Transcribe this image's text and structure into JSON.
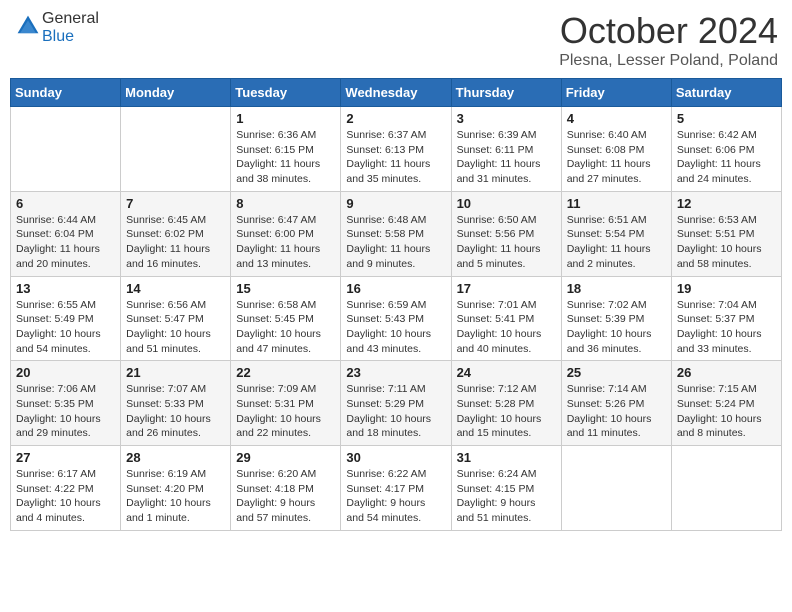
{
  "header": {
    "logo_general": "General",
    "logo_blue": "Blue",
    "month_title": "October 2024",
    "location": "Plesna, Lesser Poland, Poland"
  },
  "days_of_week": [
    "Sunday",
    "Monday",
    "Tuesday",
    "Wednesday",
    "Thursday",
    "Friday",
    "Saturday"
  ],
  "weeks": [
    [
      {
        "day": "",
        "info": ""
      },
      {
        "day": "",
        "info": ""
      },
      {
        "day": "1",
        "info": "Sunrise: 6:36 AM\nSunset: 6:15 PM\nDaylight: 11 hours and 38 minutes."
      },
      {
        "day": "2",
        "info": "Sunrise: 6:37 AM\nSunset: 6:13 PM\nDaylight: 11 hours and 35 minutes."
      },
      {
        "day": "3",
        "info": "Sunrise: 6:39 AM\nSunset: 6:11 PM\nDaylight: 11 hours and 31 minutes."
      },
      {
        "day": "4",
        "info": "Sunrise: 6:40 AM\nSunset: 6:08 PM\nDaylight: 11 hours and 27 minutes."
      },
      {
        "day": "5",
        "info": "Sunrise: 6:42 AM\nSunset: 6:06 PM\nDaylight: 11 hours and 24 minutes."
      }
    ],
    [
      {
        "day": "6",
        "info": "Sunrise: 6:44 AM\nSunset: 6:04 PM\nDaylight: 11 hours and 20 minutes."
      },
      {
        "day": "7",
        "info": "Sunrise: 6:45 AM\nSunset: 6:02 PM\nDaylight: 11 hours and 16 minutes."
      },
      {
        "day": "8",
        "info": "Sunrise: 6:47 AM\nSunset: 6:00 PM\nDaylight: 11 hours and 13 minutes."
      },
      {
        "day": "9",
        "info": "Sunrise: 6:48 AM\nSunset: 5:58 PM\nDaylight: 11 hours and 9 minutes."
      },
      {
        "day": "10",
        "info": "Sunrise: 6:50 AM\nSunset: 5:56 PM\nDaylight: 11 hours and 5 minutes."
      },
      {
        "day": "11",
        "info": "Sunrise: 6:51 AM\nSunset: 5:54 PM\nDaylight: 11 hours and 2 minutes."
      },
      {
        "day": "12",
        "info": "Sunrise: 6:53 AM\nSunset: 5:51 PM\nDaylight: 10 hours and 58 minutes."
      }
    ],
    [
      {
        "day": "13",
        "info": "Sunrise: 6:55 AM\nSunset: 5:49 PM\nDaylight: 10 hours and 54 minutes."
      },
      {
        "day": "14",
        "info": "Sunrise: 6:56 AM\nSunset: 5:47 PM\nDaylight: 10 hours and 51 minutes."
      },
      {
        "day": "15",
        "info": "Sunrise: 6:58 AM\nSunset: 5:45 PM\nDaylight: 10 hours and 47 minutes."
      },
      {
        "day": "16",
        "info": "Sunrise: 6:59 AM\nSunset: 5:43 PM\nDaylight: 10 hours and 43 minutes."
      },
      {
        "day": "17",
        "info": "Sunrise: 7:01 AM\nSunset: 5:41 PM\nDaylight: 10 hours and 40 minutes."
      },
      {
        "day": "18",
        "info": "Sunrise: 7:02 AM\nSunset: 5:39 PM\nDaylight: 10 hours and 36 minutes."
      },
      {
        "day": "19",
        "info": "Sunrise: 7:04 AM\nSunset: 5:37 PM\nDaylight: 10 hours and 33 minutes."
      }
    ],
    [
      {
        "day": "20",
        "info": "Sunrise: 7:06 AM\nSunset: 5:35 PM\nDaylight: 10 hours and 29 minutes."
      },
      {
        "day": "21",
        "info": "Sunrise: 7:07 AM\nSunset: 5:33 PM\nDaylight: 10 hours and 26 minutes."
      },
      {
        "day": "22",
        "info": "Sunrise: 7:09 AM\nSunset: 5:31 PM\nDaylight: 10 hours and 22 minutes."
      },
      {
        "day": "23",
        "info": "Sunrise: 7:11 AM\nSunset: 5:29 PM\nDaylight: 10 hours and 18 minutes."
      },
      {
        "day": "24",
        "info": "Sunrise: 7:12 AM\nSunset: 5:28 PM\nDaylight: 10 hours and 15 minutes."
      },
      {
        "day": "25",
        "info": "Sunrise: 7:14 AM\nSunset: 5:26 PM\nDaylight: 10 hours and 11 minutes."
      },
      {
        "day": "26",
        "info": "Sunrise: 7:15 AM\nSunset: 5:24 PM\nDaylight: 10 hours and 8 minutes."
      }
    ],
    [
      {
        "day": "27",
        "info": "Sunrise: 6:17 AM\nSunset: 4:22 PM\nDaylight: 10 hours and 4 minutes."
      },
      {
        "day": "28",
        "info": "Sunrise: 6:19 AM\nSunset: 4:20 PM\nDaylight: 10 hours and 1 minute."
      },
      {
        "day": "29",
        "info": "Sunrise: 6:20 AM\nSunset: 4:18 PM\nDaylight: 9 hours and 57 minutes."
      },
      {
        "day": "30",
        "info": "Sunrise: 6:22 AM\nSunset: 4:17 PM\nDaylight: 9 hours and 54 minutes."
      },
      {
        "day": "31",
        "info": "Sunrise: 6:24 AM\nSunset: 4:15 PM\nDaylight: 9 hours and 51 minutes."
      },
      {
        "day": "",
        "info": ""
      },
      {
        "day": "",
        "info": ""
      }
    ]
  ]
}
